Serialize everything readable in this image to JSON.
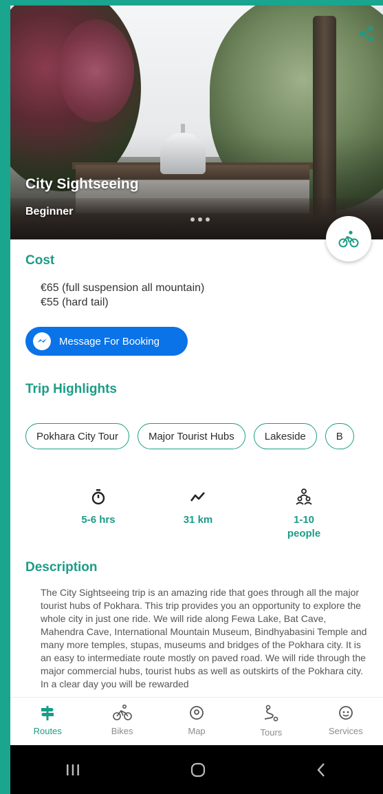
{
  "colors": {
    "accent": "#1c9c86",
    "messenger": "#0a73e8",
    "frame": "#1aa58f"
  },
  "hero": {
    "title": "City Sightseeing",
    "level": "Beginner"
  },
  "cost": {
    "title": "Cost",
    "lines": [
      "€65 (full suspension all mountain)",
      "€55 (hard tail)"
    ]
  },
  "booking": {
    "label": "Message For Booking",
    "icon": "messenger-icon"
  },
  "highlights": {
    "title": "Trip Highlights",
    "chips": [
      "Pokhara City Tour",
      "Major Tourist Hubs",
      "Lakeside",
      "B"
    ]
  },
  "stats": [
    {
      "icon": "stopwatch-icon",
      "value": "5-6 hrs"
    },
    {
      "icon": "route-icon",
      "value": "31 km"
    },
    {
      "icon": "people-icon",
      "value": "1-10\npeople"
    }
  ],
  "description": {
    "title": "Description",
    "text": "The City Sightseeing trip is an amazing ride that goes through all the major tourist hubs of Pokhara. This trip provides you an opportunity to explore the whole city in just one ride. We will ride along Fewa Lake, Bat Cave, Mahendra Cave, International Mountain Museum, Bindhyabasini Temple and many more temples, stupas, museums and bridges of the Pokhara city. It is an easy to intermediate route mostly on paved road. We will ride through the major commercial hubs, tourist hubs as well as outskirts of the Pokhara city. In a clear day you will be rewarded"
  },
  "nav": [
    {
      "label": "Routes",
      "icon": "signpost-icon",
      "active": true
    },
    {
      "label": "Bikes",
      "icon": "bicycle-icon",
      "active": false
    },
    {
      "label": "Map",
      "icon": "map-pin-icon",
      "active": false
    },
    {
      "label": "Tours",
      "icon": "tours-route-icon",
      "active": false
    },
    {
      "label": "Services",
      "icon": "services-icon",
      "active": false
    }
  ]
}
